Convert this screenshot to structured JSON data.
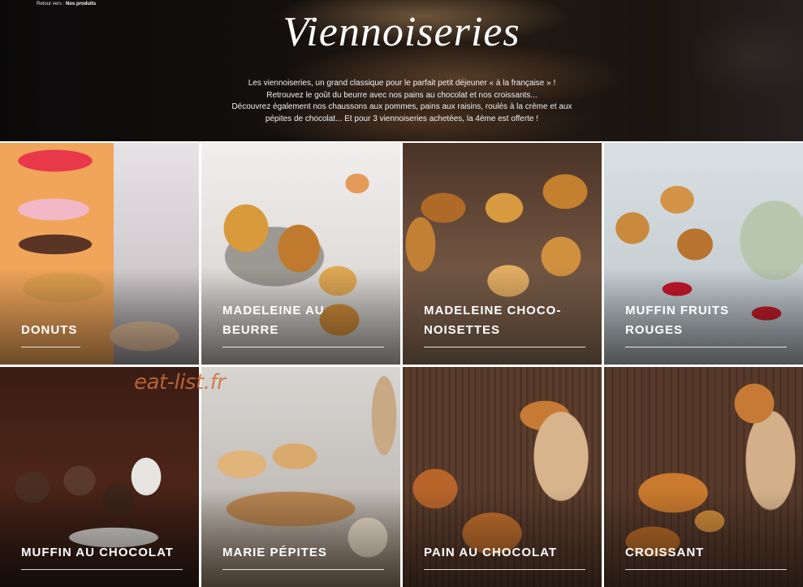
{
  "breadcrumb": {
    "prefix": "Retour vers :",
    "current": "Nos produits"
  },
  "hero": {
    "title": "Viennoiseries",
    "description_lines": [
      "Les viennoiseries, un grand classique pour le parfait petit déjeuner « à la française » !",
      "Retrouvez le goût du beurre avec nos pains au chocolat et nos croissants...",
      "Découvrez également nos chaussons aux pommes, pains aux raisins, roulés à la crème et aux",
      "pépites de chocolat... Et pour 3 viennoiseries achetées, la 4ème est offerte !"
    ]
  },
  "watermark": "eat-list.fr",
  "products": [
    {
      "label_lines": [
        "DONUTS"
      ]
    },
    {
      "label_lines": [
        "MADELEINE AU",
        "BEURRE"
      ]
    },
    {
      "label_lines": [
        "MADELEINE CHOCO-",
        "NOISETTES"
      ]
    },
    {
      "label_lines": [
        "MUFFIN FRUITS",
        "ROUGES"
      ]
    },
    {
      "label_lines": [
        "MUFFIN AU CHOCOLAT"
      ]
    },
    {
      "label_lines": [
        "MARIE PÉPITES"
      ]
    },
    {
      "label_lines": [
        "PAIN AU CHOCOLAT"
      ]
    },
    {
      "label_lines": [
        "CROISSANT"
      ]
    }
  ]
}
